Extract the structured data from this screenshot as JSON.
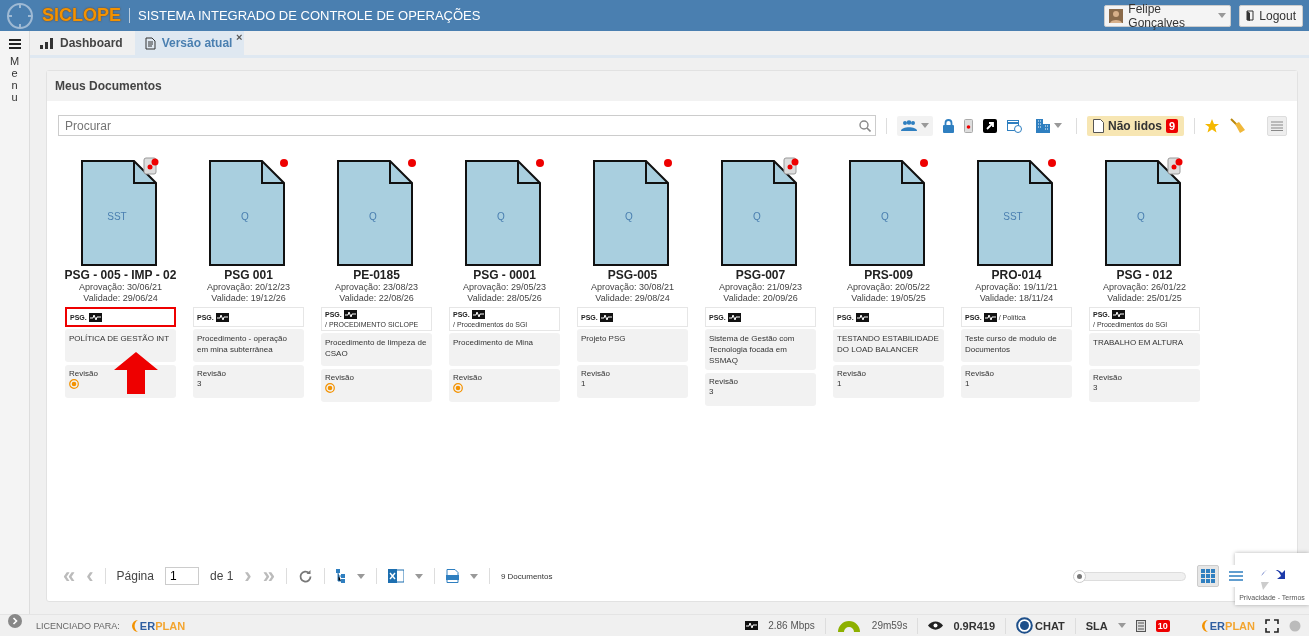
{
  "header": {
    "logo": "SICLOPE",
    "title": "SISTEMA INTEGRADO DE CONTROLE DE OPERAÇÕES",
    "user": "Felipe Gonçalves",
    "logout": "Logout"
  },
  "sidebar": {
    "label": "Menu"
  },
  "tabs": [
    {
      "label": "Dashboard",
      "selected": false
    },
    {
      "label": "Versão atual",
      "selected": true,
      "close": "×"
    }
  ],
  "panel": {
    "title": "Meus Documentos"
  },
  "toolbar": {
    "search_placeholder": "Procurar",
    "unread": {
      "label": "Não lidos",
      "count": "9"
    }
  },
  "documents": [
    {
      "type": "SST",
      "stamped": true,
      "code": "PSG - 005 - IMP - 02",
      "approval": "Aprovação: 30/06/21",
      "validity": "Validade: 29/06/24",
      "tag": "PSG.",
      "description": "POLÍTICA DE GESTÃO INT",
      "revision_label": "Revisão",
      "pending": true,
      "highlighted": true
    },
    {
      "type": "Q",
      "stamped": false,
      "code": "PSG 001",
      "approval": "Aprovação: 20/12/23",
      "validity": "Validade: 19/12/26",
      "tag": "PSG.",
      "description": "Procedimento - operação em mina subterrânea",
      "revision_label": "Revisão",
      "pending": false,
      "revision": "3",
      "highlighted": false
    },
    {
      "type": "Q",
      "stamped": false,
      "code": "PE-0185",
      "approval": "Aprovação: 23/08/23",
      "validity": "Validade: 22/08/26",
      "tag": "PSG.",
      "category": "/ PROCEDIMENTO SICLOPE",
      "description": "Procedimento de limpeza de CSAO",
      "revision_label": "Revisão",
      "pending": true,
      "highlighted": false
    },
    {
      "type": "Q",
      "stamped": false,
      "code": "PSG - 0001",
      "approval": "Aprovação: 29/05/23",
      "validity": "Validade: 28/05/26",
      "tag": "PSG.",
      "category": "/ Procedimentos do SGI",
      "description": "Procedimento de Mina",
      "revision_label": "Revisão",
      "pending": true,
      "highlighted": false
    },
    {
      "type": "Q",
      "stamped": false,
      "code": "PSG-005",
      "approval": "Aprovação: 30/08/21",
      "validity": "Validade: 29/08/24",
      "tag": "PSG.",
      "description": "Projeto PSG",
      "revision_label": "Revisão",
      "pending": false,
      "revision": "1",
      "highlighted": false
    },
    {
      "type": "Q",
      "stamped": true,
      "code": "PSG-007",
      "approval": "Aprovação: 21/09/23",
      "validity": "Validade: 20/09/26",
      "tag": "PSG.",
      "description": "Sistema de Gestão com Tecnologia focada em SSMAQ",
      "revision_label": "Revisão",
      "pending": false,
      "revision": "3",
      "highlighted": false
    },
    {
      "type": "Q",
      "stamped": false,
      "code": "PRS-009",
      "approval": "Aprovação: 20/05/22",
      "validity": "Validade: 19/05/25",
      "tag": "PSG.",
      "description": "TESTANDO ESTABILIDADE DO LOAD BALANCER",
      "revision_label": "Revisão",
      "pending": false,
      "revision": "1",
      "highlighted": false
    },
    {
      "type": "SST",
      "stamped": false,
      "code": "PRO-014",
      "approval": "Aprovação: 19/11/21",
      "validity": "Validade: 18/11/24",
      "tag": "PSG.",
      "category": "/ Política",
      "description": "Teste curso de modulo de Documentos",
      "revision_label": "Revisão",
      "pending": false,
      "revision": "1",
      "highlighted": false
    },
    {
      "type": "Q",
      "stamped": true,
      "code": "PSG - 012",
      "approval": "Aprovação: 26/01/22",
      "validity": "Validade: 25/01/25",
      "tag": "PSG.",
      "category": "/ Procedimentos do SGI",
      "description": "TRABALHO EM ALTURA",
      "revision_label": "Revisão",
      "pending": false,
      "revision": "3",
      "highlighted": false
    }
  ],
  "pagination": {
    "first": "«",
    "prev": "‹",
    "page_label": "Página",
    "page": "1",
    "of": "de 1",
    "next": "›",
    "last": "»",
    "count": "9 Documentos"
  },
  "zoom_slider": {
    "level": 0.02
  },
  "views": [
    {
      "kind": "grid",
      "selected": true
    },
    {
      "kind": "list",
      "selected": false
    }
  ],
  "recaptcha": {
    "text": "Privacidade - Termos"
  },
  "status_bar": {
    "licensed": "LICENCIADO PARA:",
    "brand_a": "ER",
    "brand_b": "PLAN",
    "speed": "2.86 Mbps",
    "session": "29m59s",
    "version": "0.9R419",
    "chat": "CHAT",
    "sla": "SLA",
    "alerts": "10",
    "brand2_a": "ER",
    "brand2_b": "PLAN"
  }
}
